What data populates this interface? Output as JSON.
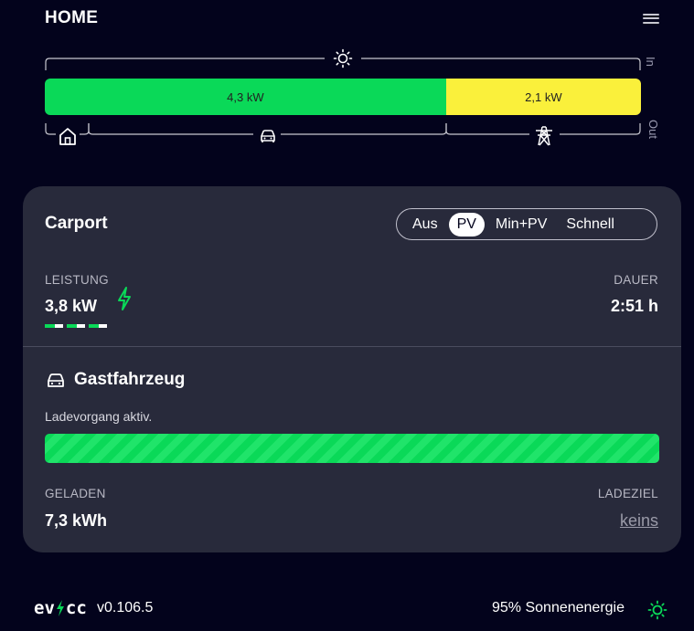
{
  "header": {
    "title": "HOME",
    "menu_icon": "hamburger-menu-icon"
  },
  "energyflow": {
    "in_label": "In",
    "out_label": "Out",
    "bar": [
      {
        "label": "4,3 kW",
        "fraction": 0.673,
        "color": "#0ad958"
      },
      {
        "label": "2,1 kW",
        "fraction": 0.327,
        "color": "#faf03b"
      }
    ],
    "icons": [
      "sun-icon",
      "home-icon",
      "car-icon",
      "grid-tower-icon"
    ]
  },
  "loadpoint": {
    "title": "Carport",
    "modes": [
      "Aus",
      "PV",
      "Min+PV",
      "Schnell"
    ],
    "active_mode": "PV",
    "power_label": "Leistung",
    "power_value": "3,8 kW",
    "duration_label": "Dauer",
    "duration_value": "2:51 h",
    "phases_active": 3,
    "vehicle": {
      "name": "Gastfahrzeug",
      "status": "Ladevorgang aktiv.",
      "progress": 1.0,
      "charged_label": "Geladen",
      "charged_value": "7,3 kWh",
      "target_label": "Ladeziel",
      "target_value": "keins"
    }
  },
  "footer": {
    "logo_text": "ev cc",
    "version": "v0.106.5",
    "solar_text": "95% Sonnenenergie"
  },
  "colors": {
    "background": "#03031c",
    "card": "#282a3b",
    "green": "#0ad958",
    "yellow": "#faf03b"
  }
}
